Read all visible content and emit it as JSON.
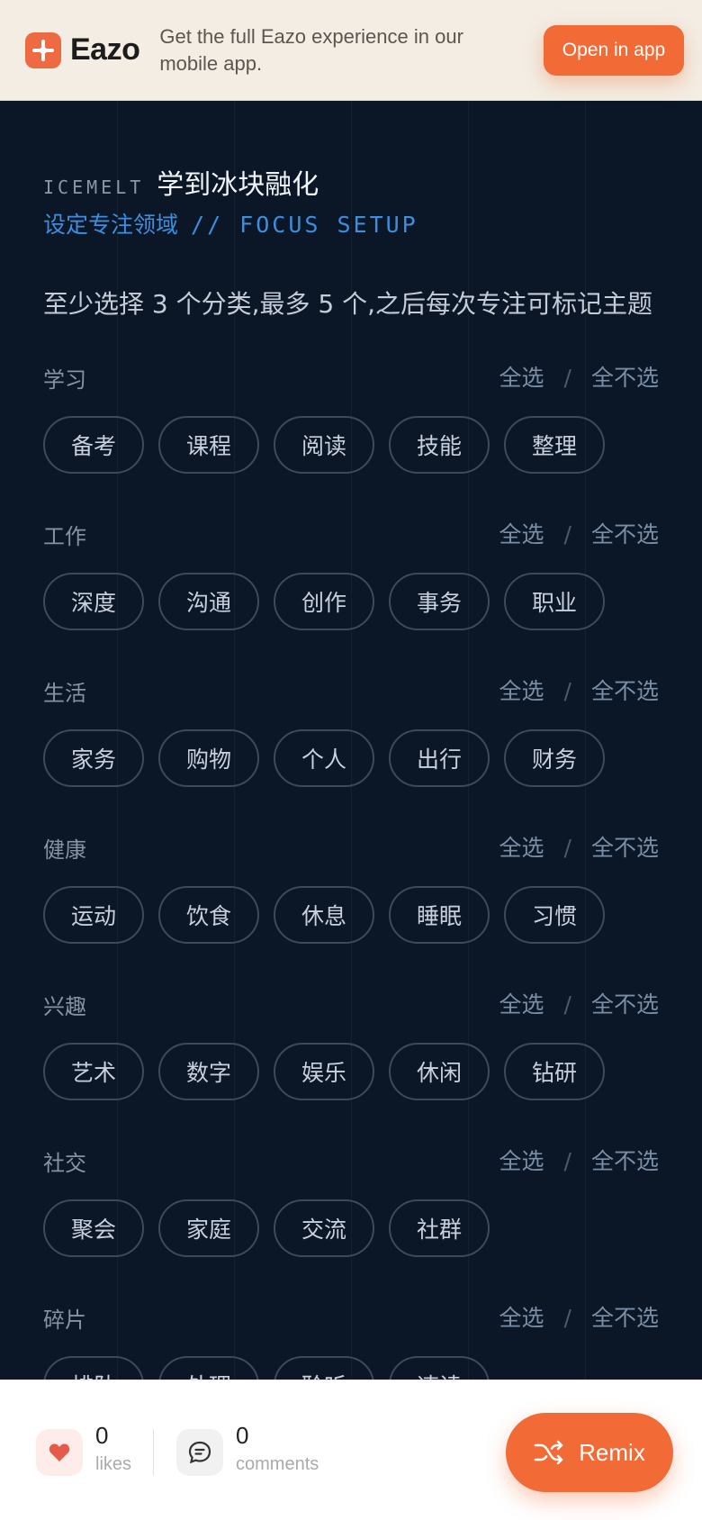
{
  "banner": {
    "logo_text": "Eazo",
    "message": "Get the full Eazo experience in our mobile app.",
    "open_button": "Open in app"
  },
  "header": {
    "brand": "ICEMELT",
    "title": "学到冰块融化",
    "subtitle_cn": "设定专注领域",
    "subtitle_en": "// FOCUS SETUP",
    "instruction": "至少选择 3 个分类,最多 5 个,之后每次专注可标记主题"
  },
  "actions": {
    "select_all": "全选",
    "separator": "/",
    "select_none": "全不选"
  },
  "sections": [
    {
      "name": "学习",
      "chips": [
        "备考",
        "课程",
        "阅读",
        "技能",
        "整理"
      ]
    },
    {
      "name": "工作",
      "chips": [
        "深度",
        "沟通",
        "创作",
        "事务",
        "职业"
      ]
    },
    {
      "name": "生活",
      "chips": [
        "家务",
        "购物",
        "个人",
        "出行",
        "财务"
      ]
    },
    {
      "name": "健康",
      "chips": [
        "运动",
        "饮食",
        "休息",
        "睡眠",
        "习惯"
      ]
    },
    {
      "name": "兴趣",
      "chips": [
        "艺术",
        "数字",
        "娱乐",
        "休闲",
        "钻研"
      ]
    },
    {
      "name": "社交",
      "chips": [
        "聚会",
        "家庭",
        "交流",
        "社群"
      ]
    },
    {
      "name": "碎片",
      "chips": [
        "排队",
        "处理",
        "聆听",
        "速读"
      ]
    }
  ],
  "footer": {
    "likes_count": "0",
    "likes_label": "likes",
    "comments_count": "0",
    "comments_label": "comments",
    "remix_label": "Remix"
  },
  "colors": {
    "accent": "#f26a35",
    "background": "#0b1626",
    "link_blue": "#3c8ee0"
  },
  "icons": [
    "eazo-logo-icon",
    "heart-icon",
    "comment-icon",
    "shuffle-icon"
  ]
}
